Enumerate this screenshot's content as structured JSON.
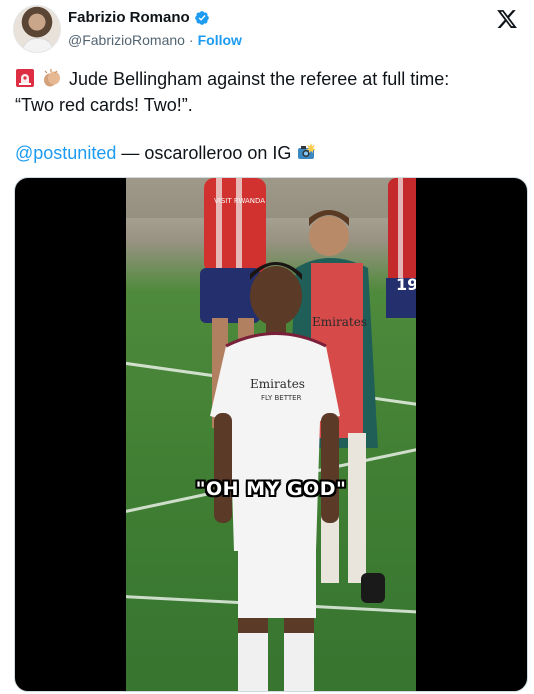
{
  "author": {
    "name": "Fabrizio Romano",
    "handle": "@FabrizioRomano",
    "separator": "·",
    "follow_label": "Follow",
    "verified_color": "#1d9bf0"
  },
  "platform_icon": "x-logo-icon",
  "tweet": {
    "emojis": [
      "rotating-light-emoji",
      "clapping-hands-emoji"
    ],
    "line1": "Jude Bellingham against the referee at full time:",
    "line2": "“Two red cards! Two!”.",
    "mention": "@postunited",
    "credit_text": "— oscarolleroo on IG",
    "credit_emoji": "camera-flash-emoji"
  },
  "media": {
    "type": "video",
    "caption": "\"OH MY GOD\"",
    "shirt_sponsor": "Emirates",
    "shirt_sponsor_sub": "FLY BETTER",
    "background_sponsor": "Emirates",
    "ad_text": "VISIT RWANDA",
    "player_number": "19"
  }
}
